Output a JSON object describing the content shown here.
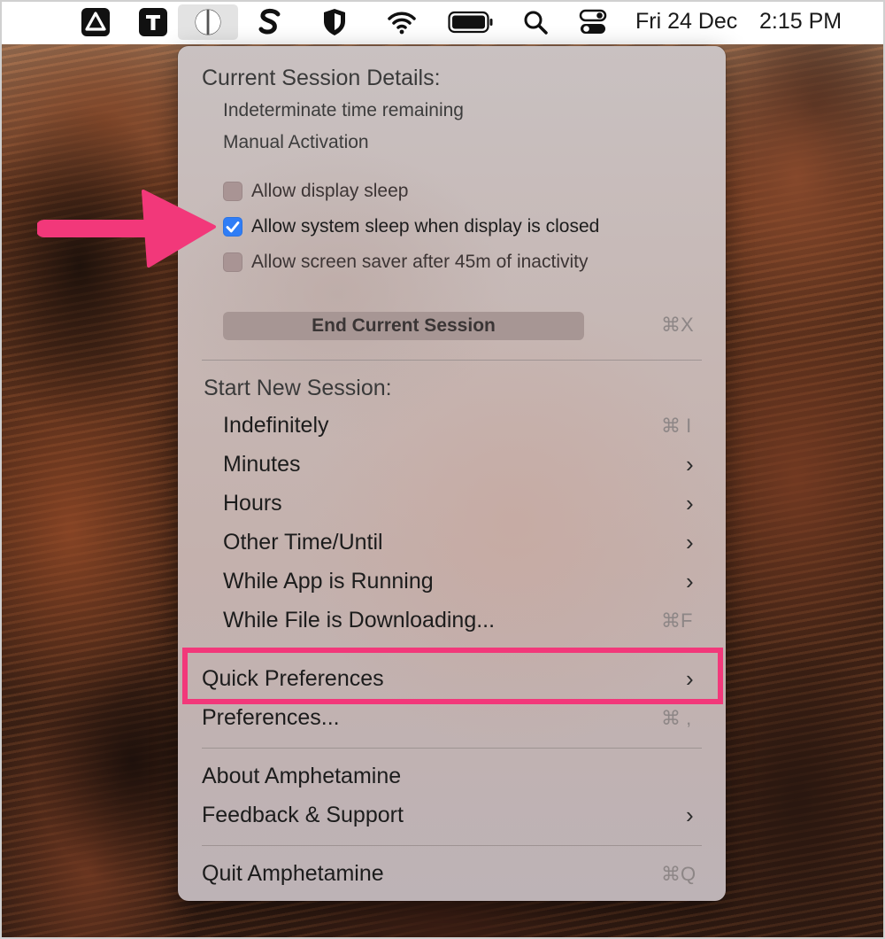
{
  "menubar": {
    "date": "Fri 24 Dec",
    "time": "2:15 PM",
    "icons": [
      "drive-icon",
      "typora-icon",
      "amphetamine-icon",
      "scrivener-icon",
      "shield-icon",
      "wifi-icon",
      "battery-icon",
      "search-icon",
      "control-center-icon"
    ]
  },
  "menu": {
    "current_session": {
      "heading": "Current Session Details:",
      "time_remaining": "Indeterminate time remaining",
      "activation": "Manual Activation"
    },
    "options": [
      {
        "label": "Allow display sleep",
        "checked": false
      },
      {
        "label": "Allow system sleep when display is closed",
        "checked": true
      },
      {
        "label": "Allow screen saver after 45m of inactivity",
        "checked": false
      }
    ],
    "end_session": {
      "label": "End Current Session",
      "shortcut": "⌘X"
    },
    "new_session": {
      "heading": "Start New Session:",
      "items": [
        {
          "label": "Indefinitely",
          "shortcut": "⌘ I",
          "submenu": false
        },
        {
          "label": "Minutes",
          "shortcut": "",
          "submenu": true
        },
        {
          "label": "Hours",
          "shortcut": "",
          "submenu": true
        },
        {
          "label": "Other Time/Until",
          "shortcut": "",
          "submenu": true
        },
        {
          "label": "While App is Running",
          "shortcut": "",
          "submenu": true
        },
        {
          "label": "While File is Downloading...",
          "shortcut": "⌘F",
          "submenu": false
        }
      ]
    },
    "quick_preferences": {
      "label": "Quick Preferences",
      "submenu": true
    },
    "preferences": {
      "label": "Preferences...",
      "shortcut": "⌘ ,"
    },
    "about": {
      "label": "About Amphetamine"
    },
    "feedback": {
      "label": "Feedback & Support",
      "submenu": true
    },
    "quit": {
      "label": "Quit Amphetamine",
      "shortcut": "⌘Q"
    }
  },
  "colors": {
    "annotation": "#f2387a",
    "checkbox_checked": "#2f7df6"
  }
}
